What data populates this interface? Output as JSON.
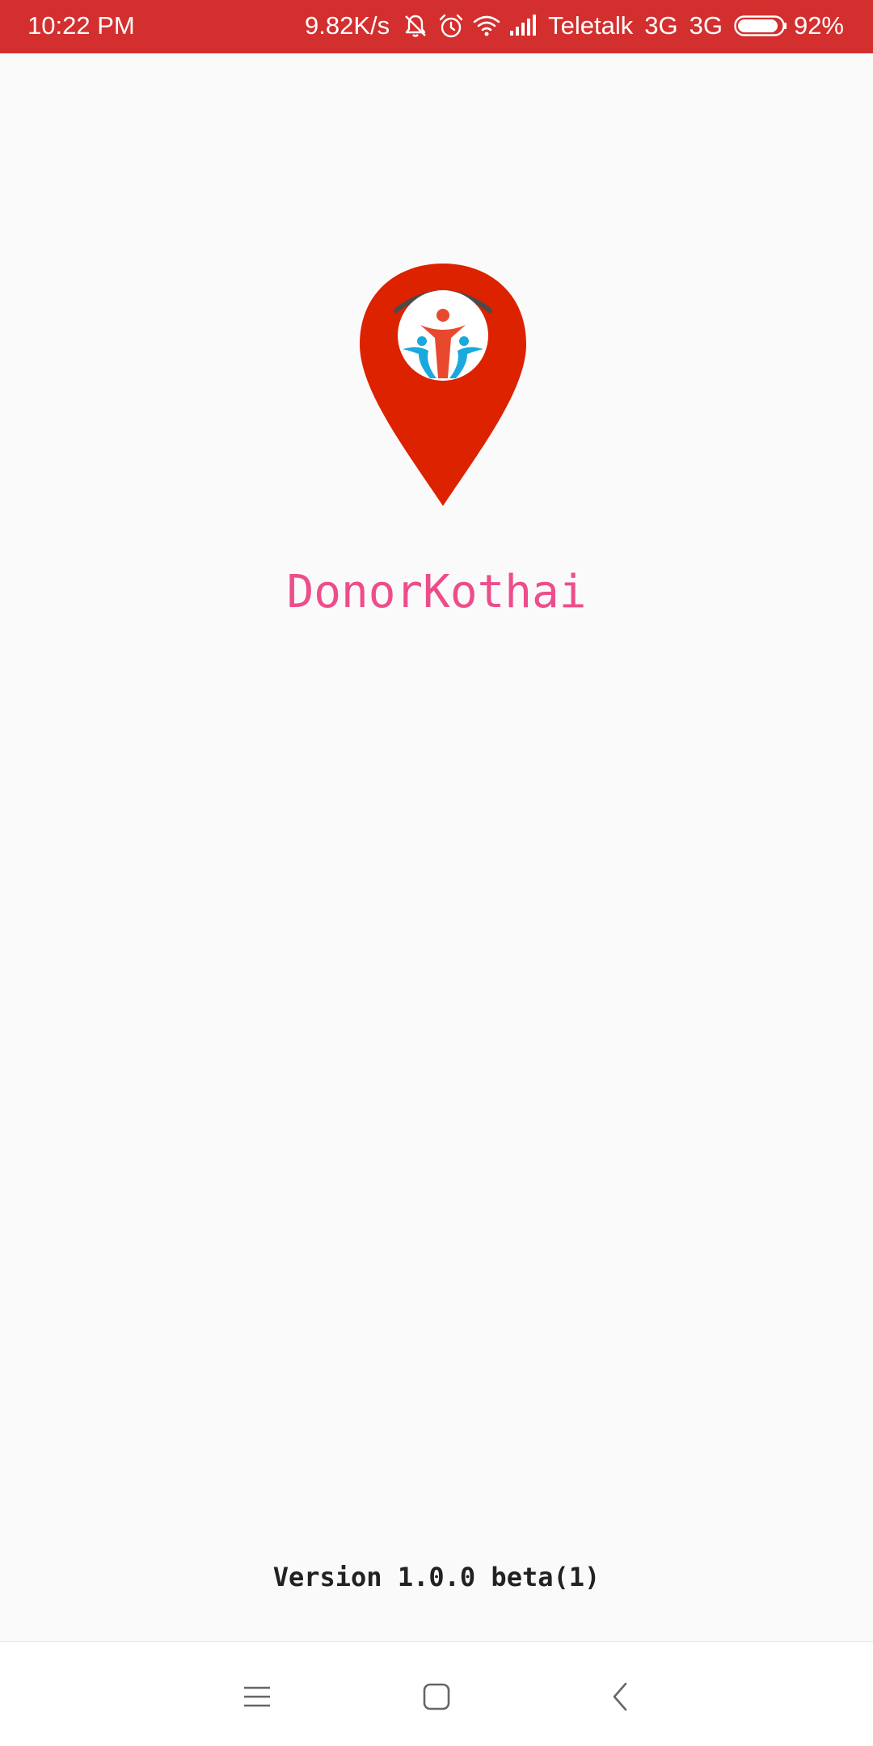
{
  "status_bar": {
    "time": "10:22 PM",
    "net_speed": "9.82K/s",
    "carrier": "Teletalk",
    "net_type_1": "3G",
    "net_type_2": "3G",
    "battery": "92%",
    "battery_level": 0.92,
    "icons": [
      "muted-bell-icon",
      "alarm-icon",
      "wifi-icon",
      "signal-icon",
      "battery-icon"
    ],
    "background_color": "#d32f2f"
  },
  "splash": {
    "app_name": "DonorKothai",
    "app_name_color": "#ee4d8b",
    "logo_icon": "location-pin-donors-logo",
    "logo_color": "#dd2200",
    "version": "Version 1.0.0 beta(1)"
  },
  "nav_bar": {
    "buttons": [
      "menu-icon",
      "home-square-icon",
      "back-chevron-icon"
    ]
  }
}
